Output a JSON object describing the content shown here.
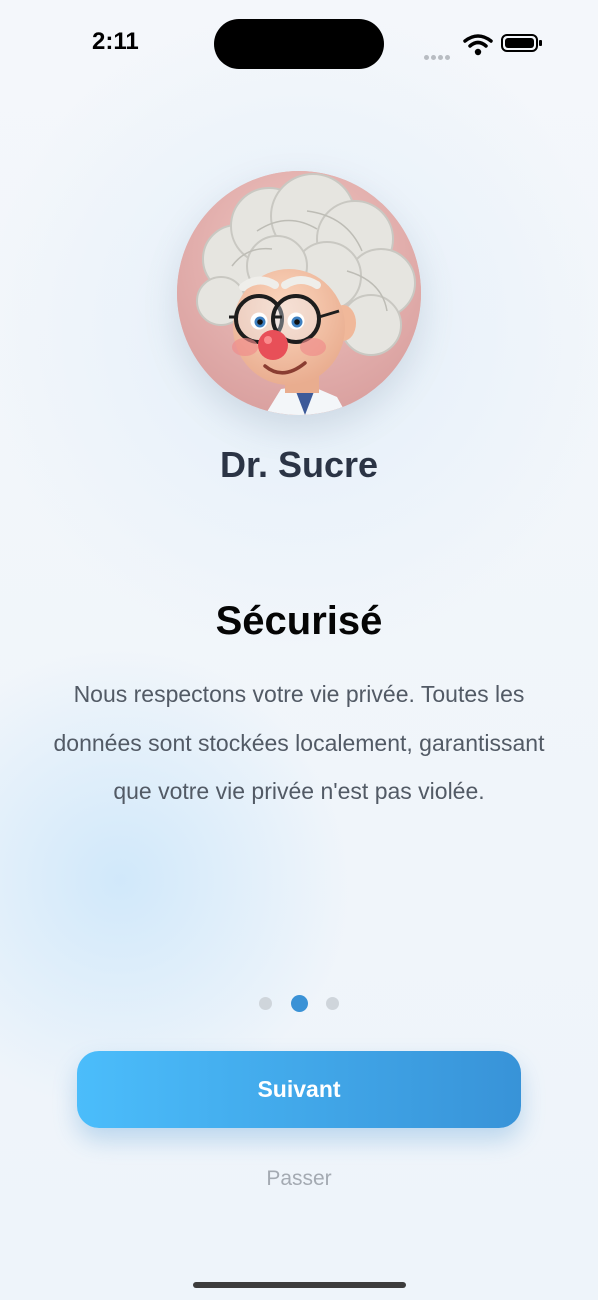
{
  "status_bar": {
    "time": "2:11"
  },
  "avatar": {
    "name": "Dr. Sucre",
    "icon": "doctor-avatar-illustration"
  },
  "onboarding": {
    "title": "Sécurisé",
    "description": "Nous respectons votre vie privée. Toutes les données sont stockées localement, garantissant que votre vie privée n'est pas violée.",
    "page_count": 3,
    "active_page": 2
  },
  "actions": {
    "next_label": "Suivant",
    "skip_label": "Passer"
  },
  "colors": {
    "accent_start": "#4bbdfb",
    "accent_end": "#3893d8",
    "title": "#050505",
    "text": "#525a65",
    "muted": "#a4aab2",
    "active_dot": "#3a92d6",
    "inactive_dot": "#cfd5db"
  }
}
